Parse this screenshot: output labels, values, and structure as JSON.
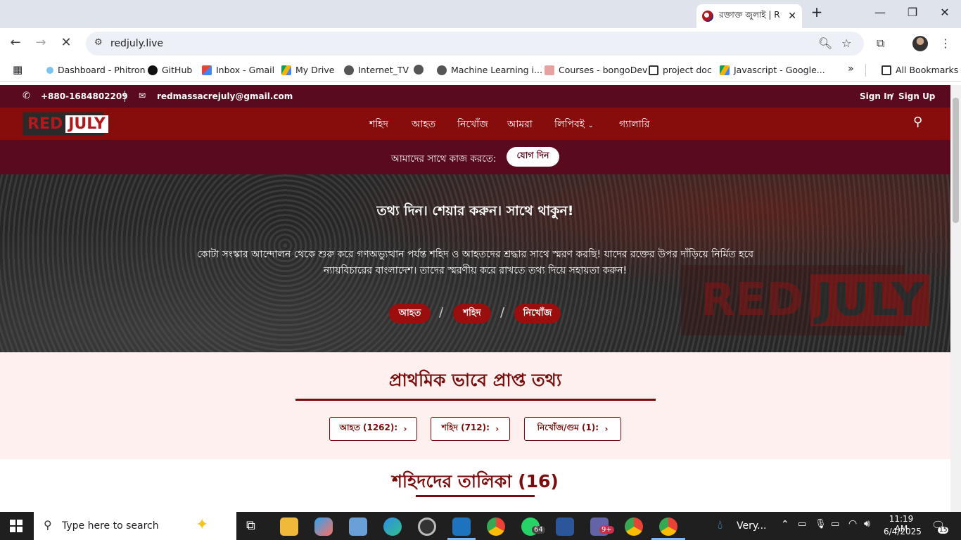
{
  "browser": {
    "tab_title": "রক্তাক্ত জুলাই | R",
    "url": "redjuly.live",
    "bookmarks": [
      "Dashboard - Phitron",
      "GitHub",
      "Inbox - Gmail",
      "My Drive",
      "Internet_TV",
      "Machine Learning i...",
      "Courses - bongoDev",
      "project doc",
      "Javascript - Google...",
      "All Bookmarks"
    ]
  },
  "site": {
    "phone": "+880-1684802209",
    "email": "redmassacrejuly@gmail.com",
    "sign_in": "Sign In",
    "sign_sep": "/",
    "sign_up": "Sign Up",
    "logo_red": "RED",
    "logo_july": "JULY",
    "nav": [
      "শহিদ",
      "আহত",
      "নিখোঁজ",
      "আমরা",
      "লিপিবই",
      "গ্যালারি"
    ],
    "join_text": "আমাদের সাথে কাজ করতে:",
    "join_button": "যোগ দিন",
    "hero_title": "তথ্য দিন। শেয়ার করুন। সাথে থাকুন!",
    "hero_text_1": "কোটা সংস্কার আন্দোলন থেকে শুরু করে গণঅভ্যুত্থান পর্যন্ত শহিদ ও আহতদের শ্রদ্ধার সাথে স্মরণ করছি! যাদের রক্তের উপর দাঁড়িয়ে নির্মিত হবে",
    "hero_text_2": "ন্যায়বিচারের বাংলাদেশ। তাদের স্মরণীয় করে রাখতে তথ্য দিয়ে সহায়তা করুন!",
    "hero_pills": [
      "আহত",
      "শহিদ",
      "নিখোঁজ"
    ],
    "hero_sep": "/",
    "hero_logo_red": "RED",
    "hero_logo_july": "JULY",
    "stats_title": "প্রাথমিক ভাবে প্রাপ্ত তথ্য",
    "stats_buttons": [
      "আহত (1262):",
      "শহিদ (712):",
      "নিখোঁজ/গুম (1):"
    ],
    "list_title": "শহিদদের তালিকা (16)"
  },
  "taskbar": {
    "search_placeholder": "Type here to search",
    "weather": "Very...",
    "time": "11:19 AM",
    "date": "6/4/2025",
    "whatsapp_badge": "64",
    "teams_badge": "9+",
    "notif_badge": "15"
  }
}
